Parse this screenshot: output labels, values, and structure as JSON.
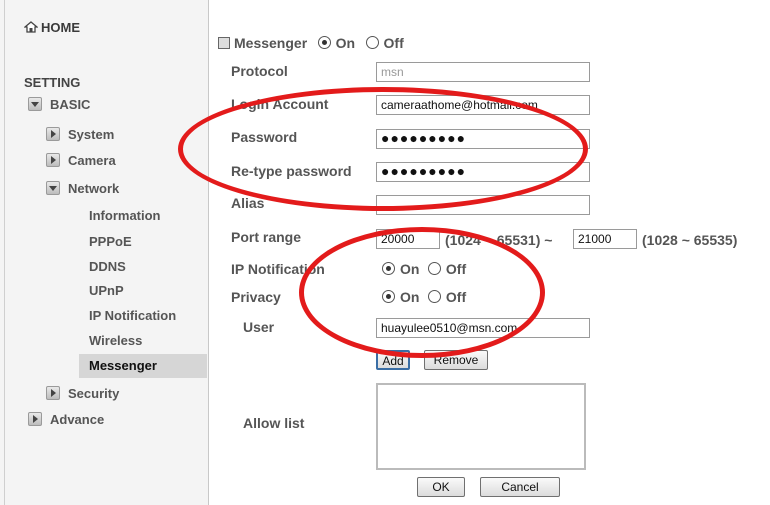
{
  "sidebar": {
    "home_label": "HOME",
    "setting_label": "SETTING",
    "basic_label": "BASIC",
    "system_label": "System",
    "camera_label": "Camera",
    "network_label": "Network",
    "network_items": [
      "Information",
      "PPPoE",
      "DDNS",
      "UPnP",
      "IP Notification",
      "Wireless",
      "Messenger"
    ],
    "active_item": "Messenger",
    "security_label": "Security",
    "advance_label": "Advance"
  },
  "messenger": {
    "title": "Messenger",
    "on_label": "On",
    "off_label": "Off",
    "state": "On"
  },
  "form": {
    "protocol_label": "Protocol",
    "protocol_value": "msn",
    "login_label": "Login Account",
    "login_value": "cameraathome@hotmail.com",
    "password_label": "Password",
    "password_value": "●●●●●●●●●",
    "retype_label": "Re-type password",
    "retype_value": "●●●●●●●●●",
    "alias_label": "Alias",
    "alias_value": "",
    "port_label": "Port range",
    "port_from": "20000",
    "port_from_range": "(1024 ~ 65531) ~",
    "port_to": "21000",
    "port_to_range": "(1028 ~ 65535)",
    "ipnotify_label": "IP Notification",
    "ipnotify_on": "On",
    "ipnotify_off": "Off",
    "ipnotify_state": "On",
    "privacy_label": "Privacy",
    "privacy_on": "On",
    "privacy_off": "Off",
    "privacy_state": "On",
    "user_label": "User",
    "user_value": "huayulee0510@msn.com",
    "add_button": "Add",
    "remove_button": "Remove",
    "allow_list_label": "Allow list",
    "ok_button": "OK",
    "cancel_button": "Cancel"
  },
  "colors": {
    "highlight": "#e31b1b",
    "sidebar_bg": "#f4f4f4",
    "active_bg": "#d6d6d6"
  }
}
